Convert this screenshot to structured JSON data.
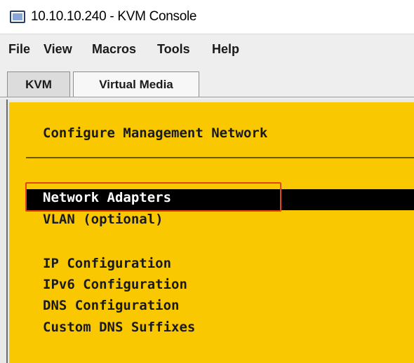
{
  "window": {
    "title": "10.10.10.240 - KVM Console",
    "icon": "monitor-icon"
  },
  "menubar": {
    "items": [
      "File",
      "View",
      "Macros",
      "Tools",
      "Help"
    ]
  },
  "tabs": [
    {
      "label": "KVM",
      "active": true
    },
    {
      "label": "Virtual Media",
      "active": false
    }
  ],
  "console": {
    "header": "Configure Management Network",
    "items": [
      {
        "label": "Network Adapters",
        "selected": true
      },
      {
        "label": "VLAN (optional)",
        "selected": false
      },
      {
        "label": "IP Configuration",
        "selected": false
      },
      {
        "label": "IPv6 Configuration",
        "selected": false
      },
      {
        "label": "DNS Configuration",
        "selected": false
      },
      {
        "label": "Custom DNS Suffixes",
        "selected": false
      }
    ],
    "colors": {
      "background": "#f9c800",
      "text": "#1a1a1a",
      "selected_background": "#000000",
      "selected_text": "#ffffff",
      "highlight_box": "#e3441a"
    }
  }
}
